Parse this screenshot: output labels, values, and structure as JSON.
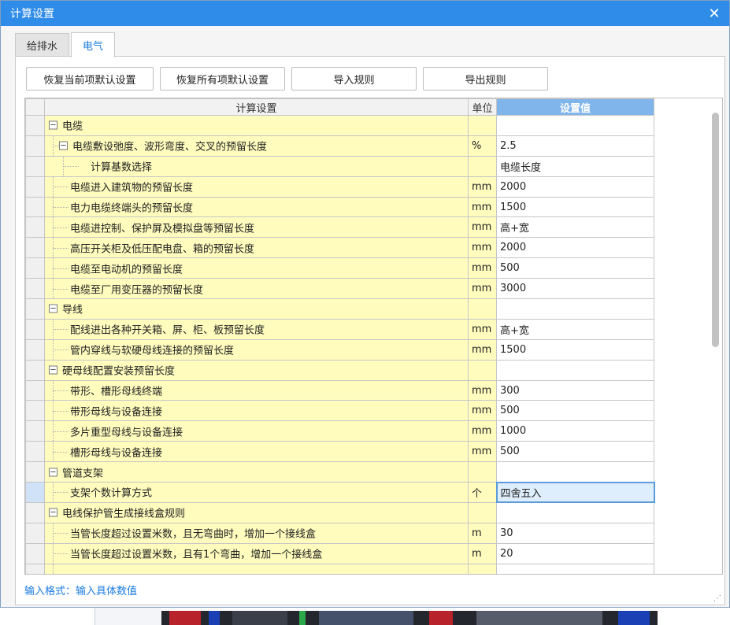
{
  "dialog": {
    "title": "计算设置",
    "tabs": [
      {
        "label": "给排水",
        "active": false
      },
      {
        "label": "电气",
        "active": true
      }
    ],
    "buttons": {
      "restore_current": "恢复当前项默认设置",
      "restore_all": "恢复所有项默认设置",
      "import_rules": "导入规则",
      "export_rules": "导出规则"
    },
    "grid": {
      "headers": {
        "name": "计算设置",
        "unit": "单位",
        "value": "设置值"
      },
      "rows": [
        {
          "name": "电缆",
          "level": 0,
          "group": true,
          "unit": "",
          "value": ""
        },
        {
          "name": "电缆敷设弛度、波形弯度、交叉的预留长度",
          "level": 1,
          "group": true,
          "unit": "%",
          "value": "2.5"
        },
        {
          "name": "计算基数选择",
          "level": 2,
          "unit": "",
          "value": "电缆长度"
        },
        {
          "name": "电缆进入建筑物的预留长度",
          "level": 1,
          "unit": "mm",
          "value": "2000"
        },
        {
          "name": "电力电缆终端头的预留长度",
          "level": 1,
          "unit": "mm",
          "value": "1500"
        },
        {
          "name": "电缆进控制、保护屏及模拟盘等预留长度",
          "level": 1,
          "unit": "mm",
          "value": "高+宽"
        },
        {
          "name": "高压开关柜及低压配电盘、箱的预留长度",
          "level": 1,
          "unit": "mm",
          "value": "2000"
        },
        {
          "name": "电缆至电动机的预留长度",
          "level": 1,
          "unit": "mm",
          "value": "500"
        },
        {
          "name": "电缆至厂用变压器的预留长度",
          "level": 1,
          "unit": "mm",
          "value": "3000"
        },
        {
          "name": "导线",
          "level": 0,
          "group": true,
          "unit": "",
          "value": ""
        },
        {
          "name": "配线进出各种开关箱、屏、柜、板预留长度",
          "level": 1,
          "unit": "mm",
          "value": "高+宽"
        },
        {
          "name": "管内穿线与软硬母线连接的预留长度",
          "level": 1,
          "unit": "mm",
          "value": "1500"
        },
        {
          "name": "硬母线配置安装预留长度",
          "level": 0,
          "group": true,
          "unit": "",
          "value": ""
        },
        {
          "name": "带形、槽形母线终端",
          "level": 1,
          "unit": "mm",
          "value": "300"
        },
        {
          "name": "带形母线与设备连接",
          "level": 1,
          "unit": "mm",
          "value": "500"
        },
        {
          "name": "多片重型母线与设备连接",
          "level": 1,
          "unit": "mm",
          "value": "1000"
        },
        {
          "name": "槽形母线与设备连接",
          "level": 1,
          "unit": "mm",
          "value": "500"
        },
        {
          "name": "管道支架",
          "level": 0,
          "group": true,
          "unit": "",
          "value": ""
        },
        {
          "name": "支架个数计算方式",
          "level": 1,
          "unit": "个",
          "value": "四舍五入",
          "selected": true
        },
        {
          "name": "电线保护管生成接线盒规则",
          "level": 0,
          "group": true,
          "unit": "",
          "value": ""
        },
        {
          "name": "当管长度超过设置米数，且无弯曲时，增加一个接线盒",
          "level": 1,
          "unit": "m",
          "value": "30"
        },
        {
          "name": "当管长度超过设置米数，且有1个弯曲，增加一个接线盒",
          "level": 1,
          "unit": "m",
          "value": "20"
        },
        {
          "name": "",
          "level": 1,
          "unit": "",
          "value": ""
        }
      ]
    },
    "hint": "输入格式：输入具体数值",
    "colors": {
      "titlebar": "#2f8ce8",
      "active_tab_text": "#1a7be0",
      "name_cell": "#fffcbe",
      "value_header": "#7fb5ea",
      "selection": "#5b9bdb"
    }
  }
}
